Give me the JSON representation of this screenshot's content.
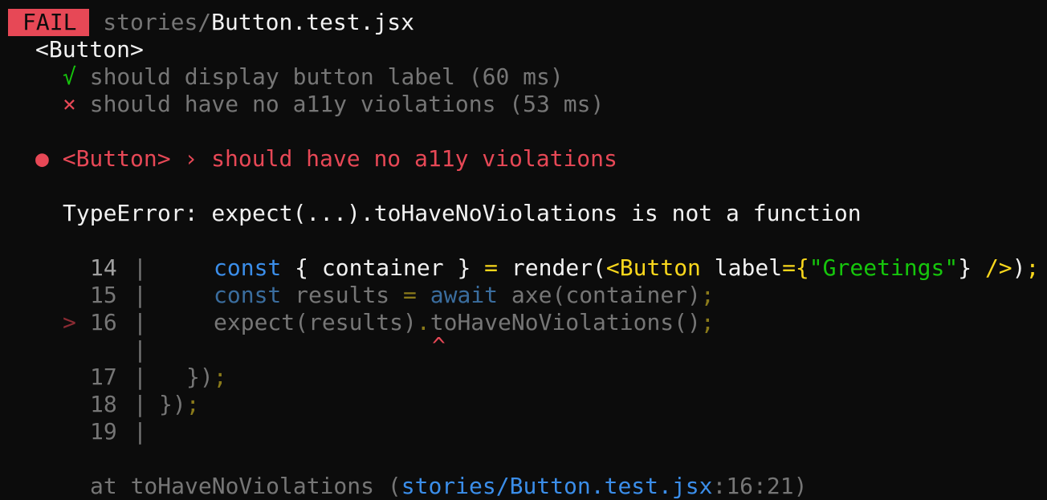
{
  "header": {
    "status_badge": "FAIL",
    "path_dir": "stories/",
    "path_file": "Button.test.jsx"
  },
  "suite": {
    "name": "<Button>",
    "tests": [
      {
        "mark": "√",
        "label": "should display button label (60 ms)",
        "status": "pass"
      },
      {
        "mark": "×",
        "label": "should have no a11y violations (53 ms)",
        "status": "fail"
      }
    ]
  },
  "failure": {
    "bullet": "●",
    "title": "<Button> › should have no a11y violations",
    "error": "TypeError: expect(...).toHaveNoViolations is not a function"
  },
  "code_frame": {
    "lines": [
      {
        "num": "14"
      },
      {
        "num": "15"
      },
      {
        "num": "16",
        "marker": ">"
      },
      {
        "num": ""
      },
      {
        "num": "17"
      },
      {
        "num": "18"
      },
      {
        "num": "19"
      }
    ],
    "separator": "|",
    "caret": "^",
    "tokens": {
      "const": "const",
      "open_brace": "{",
      "container": "container",
      "close_brace": "}",
      "equals": "=",
      "render": "render(",
      "button_tag": "<Button",
      "label_attr": "label",
      "attr_eq": "={",
      "greeting": "\"Greetings\"",
      "attr_close": "}",
      "self_close": "/>",
      "paren_close": ")",
      "semicolon": ";",
      "results": "results",
      "await": "await",
      "axe_call": "axe(container)",
      "expect_call": "expect(results)",
      "dot": ".",
      "method_call": "toHaveNoViolations()",
      "inner_close": "})",
      "outer_close": "})"
    }
  },
  "stack": {
    "prefix": "at toHaveNoViolations (",
    "location": "stories/Button.test.jsx",
    "position": ":16:21)"
  },
  "colors": {
    "background": "#0c0c0c",
    "fail_badge": "#e74856",
    "pass_green": "#16c60c",
    "error_red": "#e74856",
    "keyword_blue": "#3b8eea",
    "jsx_yellow": "#f9d71c"
  }
}
